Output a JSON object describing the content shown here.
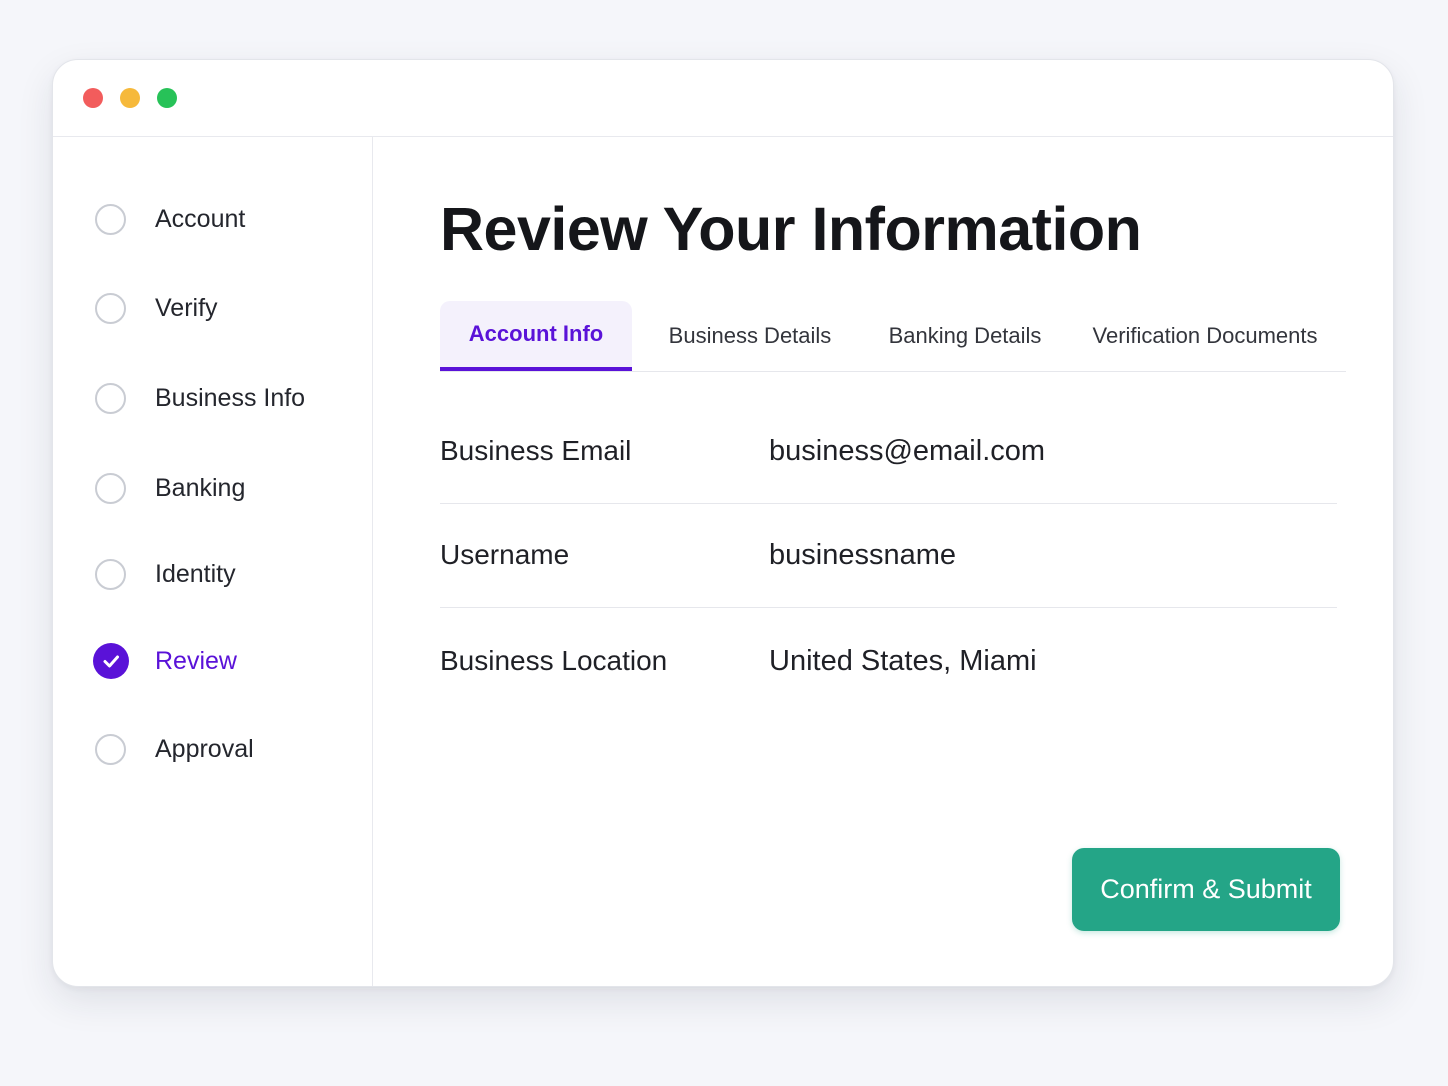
{
  "window": {
    "controls": [
      "close",
      "minimize",
      "maximize"
    ]
  },
  "steps": [
    {
      "label": "Account",
      "status": "pending"
    },
    {
      "label": "Verify",
      "status": "pending"
    },
    {
      "label": "Business Info",
      "status": "pending"
    },
    {
      "label": "Banking",
      "status": "pending"
    },
    {
      "label": "Identity",
      "status": "pending"
    },
    {
      "label": "Review",
      "status": "current"
    },
    {
      "label": "Approval",
      "status": "pending"
    }
  ],
  "main": {
    "title": "Review Your Information",
    "tabs": [
      {
        "label": "Account Info",
        "active": true
      },
      {
        "label": "Business Details",
        "active": false
      },
      {
        "label": "Banking Details",
        "active": false
      },
      {
        "label": "Verification Documents",
        "active": false
      }
    ],
    "fields": [
      {
        "label": "Business Email",
        "value": "business@email.com"
      },
      {
        "label": "Username",
        "value": "businessname"
      },
      {
        "label": "Business Location",
        "value": "United States, Miami"
      }
    ],
    "submit_label": "Confirm & Submit"
  },
  "colors": {
    "accent": "#5a12d8",
    "submit": "#24a587",
    "close": "#f25c5c",
    "minimize": "#f6b93b",
    "maximize": "#27c258"
  }
}
